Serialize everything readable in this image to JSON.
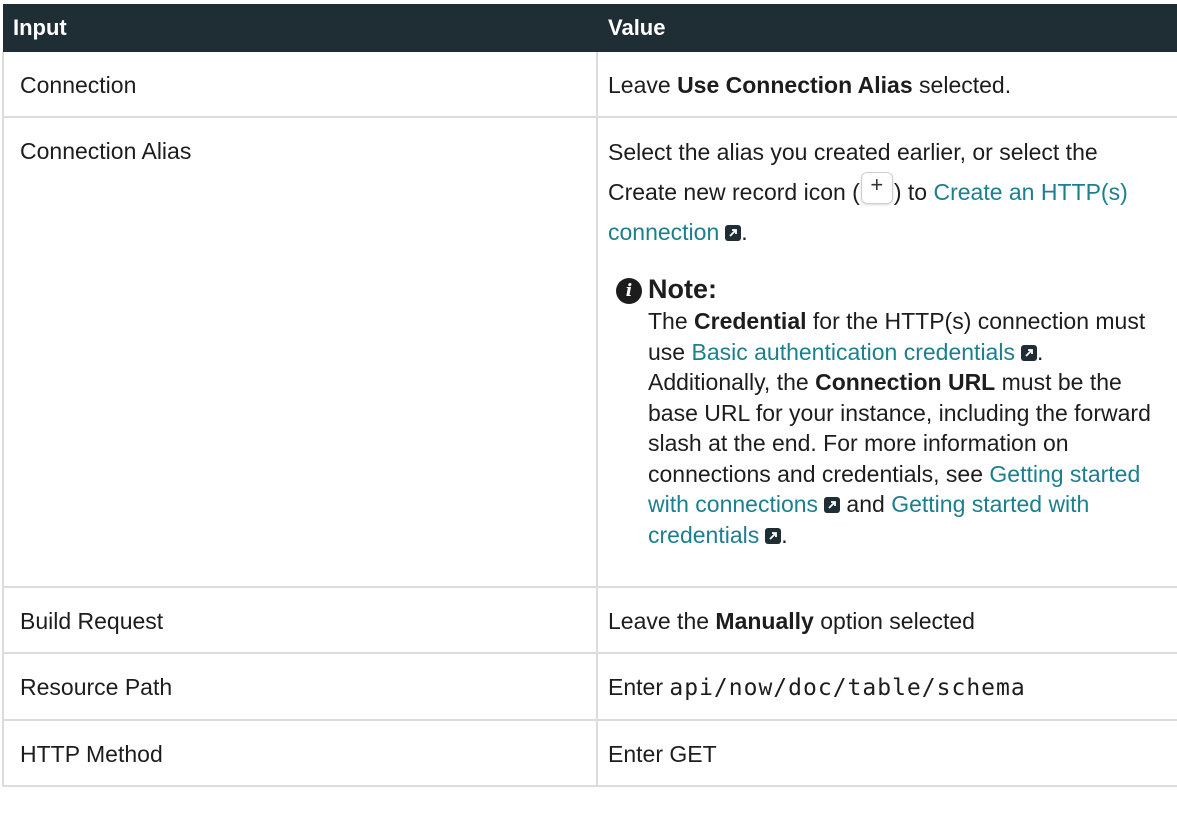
{
  "table": {
    "headers": [
      "Input",
      "Value"
    ],
    "rows": {
      "connection": {
        "input": "Connection",
        "value_prefix": "Leave ",
        "value_bold": "Use Connection Alias",
        "value_suffix": " selected."
      },
      "alias": {
        "input": "Connection Alias",
        "text_1": "Select the alias you created earlier, or select the Create new record icon (",
        "plus": "+",
        "text_2": ") to ",
        "link_create": "Create an HTTP(s) connection",
        "text_3": ".",
        "note": {
          "title": "Note:",
          "t1": "The ",
          "b1": "Credential",
          "t2": " for the HTTP(s) connection must use ",
          "link_basic": "Basic authentication credentials",
          "t3": ". Additionally, the ",
          "b2": "Connection URL",
          "t4": " must be the base URL for your instance, including the forward slash at the end. For more information on connections and credentials, see ",
          "link_conn": "Getting started with connections",
          "t5": " and ",
          "link_cred": "Getting started with credentials",
          "t6": "."
        }
      },
      "build_request": {
        "input": "Build Request",
        "value_prefix": "Leave the ",
        "value_bold": "Manually",
        "value_suffix": " option selected"
      },
      "resource_path": {
        "input": "Resource Path",
        "value_prefix": "Enter ",
        "value_code": "api/now/doc/table/schema"
      },
      "http_method": {
        "input": "HTTP Method",
        "value_prefix": "Enter ",
        "value_code": "GET"
      }
    }
  },
  "icons": {
    "external_link": "external-link-icon",
    "info": "info-icon"
  },
  "colors": {
    "header_bg": "#1f2d35",
    "link": "#1b7f8e"
  }
}
